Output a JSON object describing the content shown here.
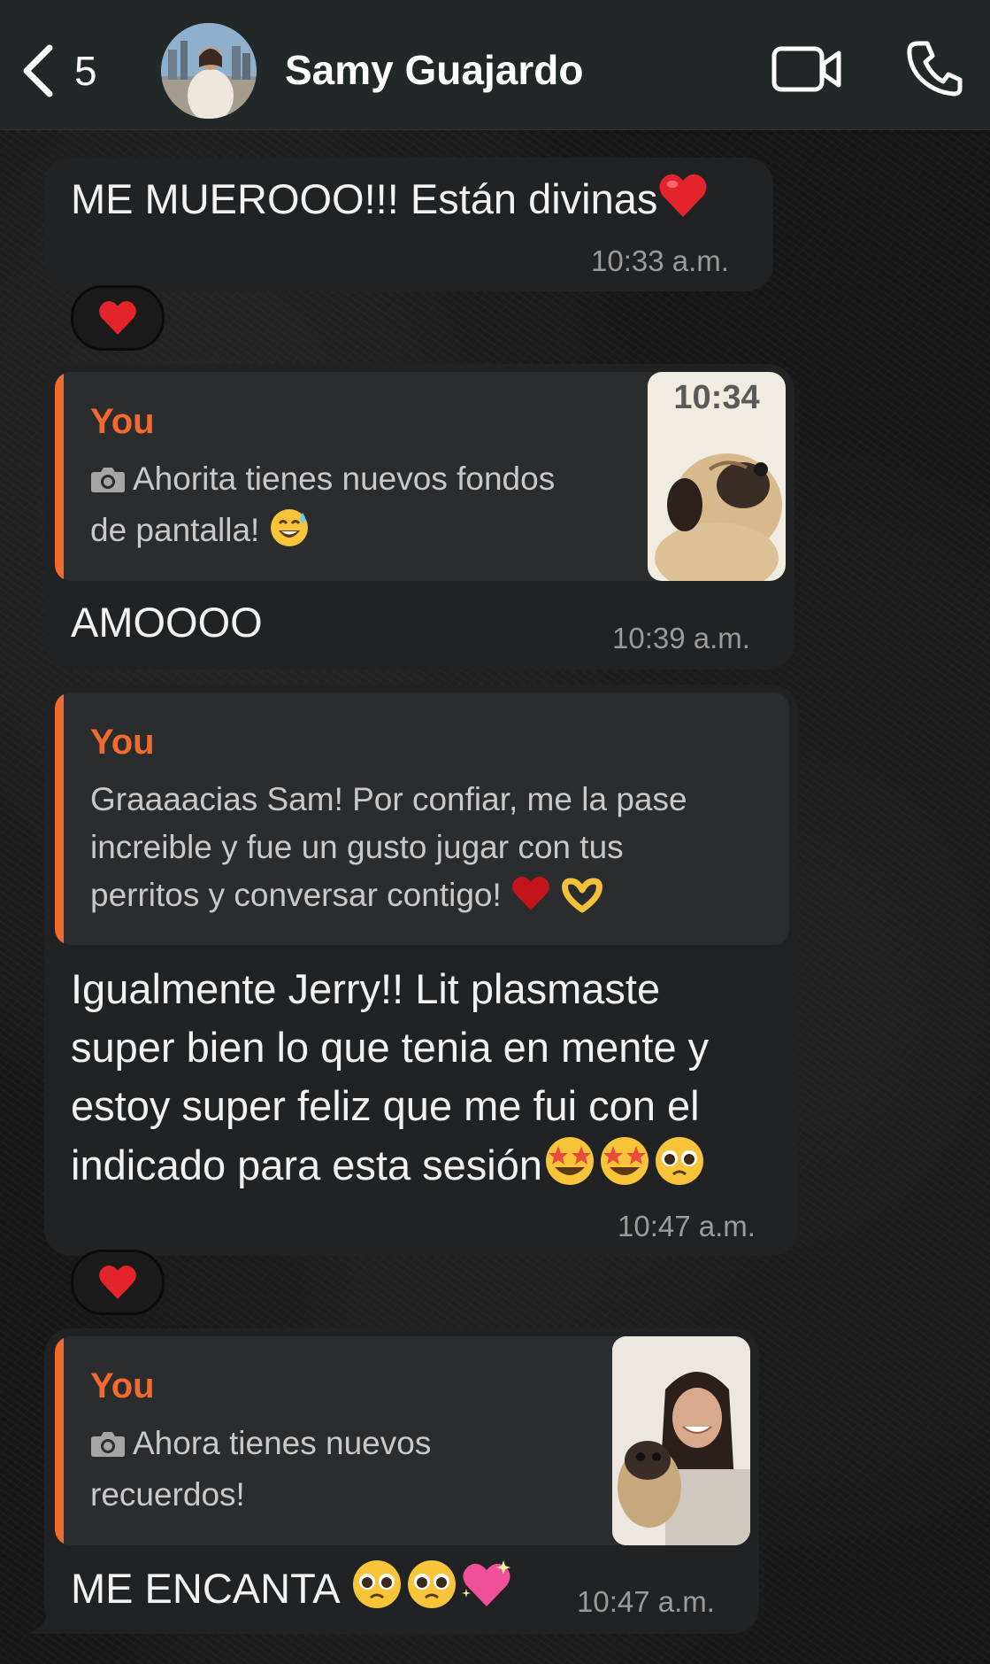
{
  "header": {
    "back_count": "5",
    "contact_name": "Samy Guajardo",
    "avatar_icon": "contact-avatar",
    "video_icon": "video-camera-icon",
    "call_icon": "phone-icon"
  },
  "messages": [
    {
      "text": "ME MUEROOO!!! Están divinas",
      "emoji": "heart",
      "time": "10:33 a.m.",
      "reaction": "heart"
    },
    {
      "quote": {
        "author": "You",
        "line1": "Ahorita tienes nuevos fondos",
        "line2": "de pantalla!",
        "icon": "camera-icon",
        "thumb_clock": "10:34"
      },
      "text": "AMOOOO",
      "time": "10:39 a.m."
    },
    {
      "quote": {
        "author": "You",
        "line1": "Graaaacias Sam! Por confiar, me la pase",
        "line2": "increible y fue un gusto jugar con tus",
        "line3": "perritos y conversar contigo!"
      },
      "line1": "Igualmente Jerry!! Lit plasmaste",
      "line2": "super bien lo que tenia en mente y",
      "line3": "estoy super feliz que me fui con el",
      "line4": "indicado para esta sesión",
      "time": "10:47 a.m.",
      "reaction": "heart"
    },
    {
      "quote": {
        "author": "You",
        "line1": "Ahora tienes nuevos",
        "line2": "recuerdos!",
        "icon": "camera-icon"
      },
      "text": "ME ENCANTA",
      "time": "10:47 a.m."
    }
  ],
  "colors": {
    "accent": "#f26a2e",
    "bubble": "#202223",
    "header": "#222728"
  }
}
